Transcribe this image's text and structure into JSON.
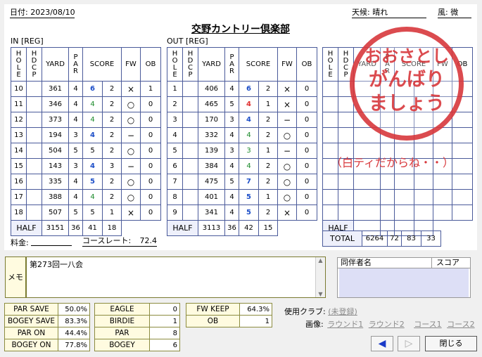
{
  "card": {
    "date": "日付: 2023/08/10",
    "weather": "天候: 晴れ",
    "wind": "風: 微",
    "course": "交野カントリー倶楽部",
    "in_label": "IN [REG]",
    "out_label": "OUT [REG]",
    "fee_label": "料金:",
    "rating_label": "コースレート:",
    "rating": "72.4"
  },
  "headers": {
    "hole": "HOLE",
    "hdcp": "HDCP",
    "yard": "YARD",
    "par": "PAR",
    "score": "SCORE",
    "fw": "FW",
    "ob": "OB"
  },
  "in_rows": [
    {
      "hole": "10",
      "yard": "361",
      "par": "4",
      "score": "6",
      "putt": "2",
      "fw": "×",
      "ob": "1",
      "c": "blue"
    },
    {
      "hole": "11",
      "yard": "346",
      "par": "4",
      "score": "4",
      "putt": "2",
      "fw": "○",
      "ob": "0",
      "c": "grn"
    },
    {
      "hole": "12",
      "yard": "373",
      "par": "4",
      "score": "4",
      "putt": "2",
      "fw": "○",
      "ob": "0",
      "c": "grn"
    },
    {
      "hole": "13",
      "yard": "194",
      "par": "3",
      "score": "4",
      "putt": "2",
      "fw": "−",
      "ob": "0",
      "c": "blue"
    },
    {
      "hole": "14",
      "yard": "504",
      "par": "5",
      "score": "5",
      "putt": "2",
      "fw": "○",
      "ob": "0",
      "c": ""
    },
    {
      "hole": "15",
      "yard": "143",
      "par": "3",
      "score": "4",
      "putt": "3",
      "fw": "−",
      "ob": "0",
      "c": "blue"
    },
    {
      "hole": "16",
      "yard": "335",
      "par": "4",
      "score": "5",
      "putt": "2",
      "fw": "○",
      "ob": "0",
      "c": "blue"
    },
    {
      "hole": "17",
      "yard": "388",
      "par": "4",
      "score": "4",
      "putt": "2",
      "fw": "○",
      "ob": "0",
      "c": "grn"
    },
    {
      "hole": "18",
      "yard": "507",
      "par": "5",
      "score": "5",
      "putt": "1",
      "fw": "×",
      "ob": "0",
      "c": ""
    }
  ],
  "in_half": {
    "label": "HALF",
    "yard": "3151",
    "par": "36",
    "score": "41",
    "putt": "18"
  },
  "out_rows": [
    {
      "hole": "1",
      "yard": "406",
      "par": "4",
      "score": "6",
      "putt": "2",
      "fw": "×",
      "ob": "0",
      "c": "blue"
    },
    {
      "hole": "2",
      "yard": "465",
      "par": "5",
      "score": "4",
      "putt": "1",
      "fw": "×",
      "ob": "0",
      "c": "red"
    },
    {
      "hole": "3",
      "yard": "170",
      "par": "3",
      "score": "4",
      "putt": "2",
      "fw": "−",
      "ob": "0",
      "c": "blue"
    },
    {
      "hole": "4",
      "yard": "332",
      "par": "4",
      "score": "4",
      "putt": "2",
      "fw": "○",
      "ob": "0",
      "c": "grn"
    },
    {
      "hole": "5",
      "yard": "139",
      "par": "3",
      "score": "3",
      "putt": "1",
      "fw": "−",
      "ob": "0",
      "c": "grn"
    },
    {
      "hole": "6",
      "yard": "384",
      "par": "4",
      "score": "4",
      "putt": "2",
      "fw": "○",
      "ob": "0",
      "c": "grn"
    },
    {
      "hole": "7",
      "yard": "475",
      "par": "5",
      "score": "7",
      "putt": "2",
      "fw": "○",
      "ob": "0",
      "c": "blue"
    },
    {
      "hole": "8",
      "yard": "401",
      "par": "4",
      "score": "5",
      "putt": "1",
      "fw": "○",
      "ob": "0",
      "c": "blue"
    },
    {
      "hole": "9",
      "yard": "341",
      "par": "4",
      "score": "5",
      "putt": "2",
      "fw": "×",
      "ob": "0",
      "c": "blue"
    }
  ],
  "out_half": {
    "label": "HALF",
    "yard": "3113",
    "par": "36",
    "score": "42",
    "putt": "15"
  },
  "third": {
    "half": "HALF",
    "total": "TOTAL",
    "total_yard": "6264",
    "total_par": "72",
    "total_score": "83",
    "total_putt": "33"
  },
  "stamp": {
    "l1": "おおさとし",
    "l2": "がんばり",
    "l3": "ましょう",
    "note": "（白ティだからね・・）"
  },
  "memo": {
    "label": "メモ",
    "text": "第273回一八会"
  },
  "companions": {
    "name_header": "同伴者名",
    "score_header": "スコア"
  },
  "stats1": [
    {
      "k": "PAR SAVE",
      "v": "50.0%"
    },
    {
      "k": "BOGEY SAVE",
      "v": "83.3%"
    },
    {
      "k": "PAR ON",
      "v": "44.4%"
    },
    {
      "k": "BOGEY ON",
      "v": "77.8%"
    }
  ],
  "stats2": [
    {
      "k": "EAGLE",
      "v": "0"
    },
    {
      "k": "BIRDIE",
      "v": "1"
    },
    {
      "k": "PAR",
      "v": "8"
    },
    {
      "k": "BOGEY",
      "v": "6"
    }
  ],
  "stats3": [
    {
      "k": "FW KEEP",
      "v": "64.3%"
    },
    {
      "k": "OB",
      "v": "1"
    }
  ],
  "clubs": {
    "label": "使用クラブ:",
    "value": "(未登録)"
  },
  "images": {
    "label": "画像:",
    "r1": "ラウンド1",
    "r2": "ラウンド2",
    "c1": "コース1",
    "c2": "コース2"
  },
  "buttons": {
    "prev": "◀",
    "next": "▷",
    "close": "閉じる"
  }
}
